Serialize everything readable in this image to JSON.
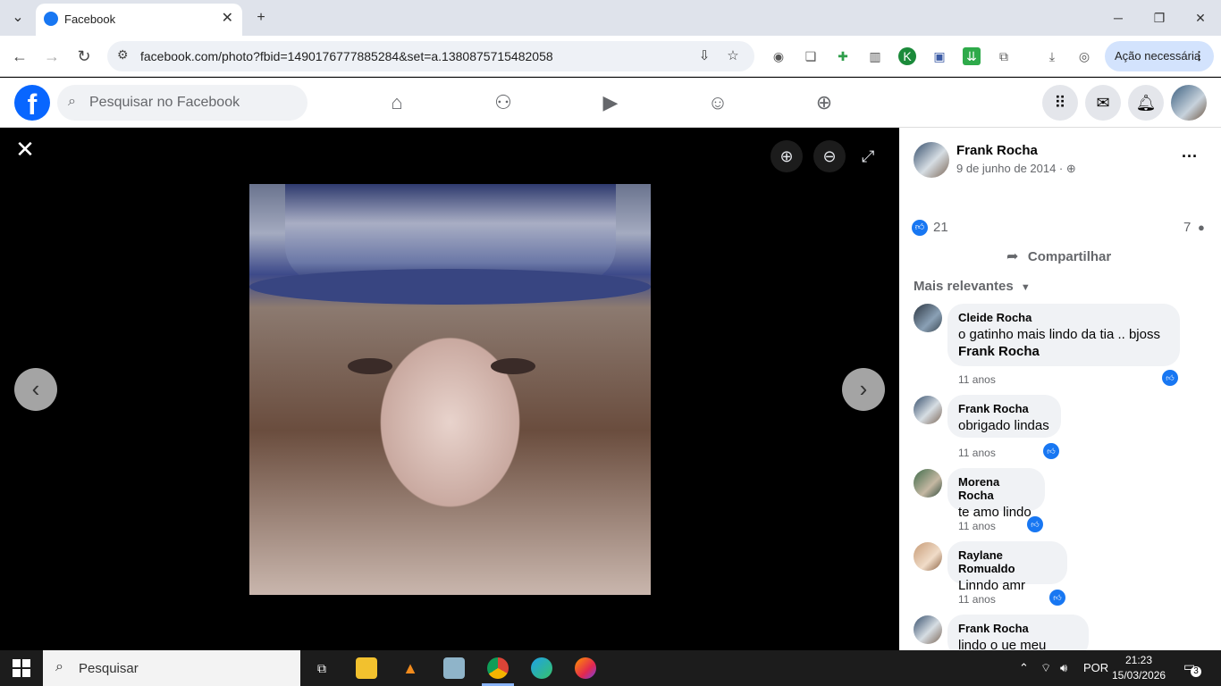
{
  "browser": {
    "tab_title": "Facebook",
    "tab_close": "✕",
    "new_tab": "+",
    "url": "facebook.com/photo?fbid=1490176777885284&set=a.1380875715482058",
    "action_button": "Ação necessária",
    "icons": [
      "back-icon",
      "forward-icon",
      "reload-icon",
      "site-info-icon",
      "install-app-icon",
      "bookmark-star-icon",
      "camera-icon",
      "copy-icon",
      "extension-plus-icon",
      "trash-icon",
      "k-extension-icon",
      "save-icon",
      "download-extension-icon",
      "puzzle-icon",
      "download-icon",
      "profile-icon",
      "kebab-menu-icon"
    ]
  },
  "facebook": {
    "search_placeholder": "Pesquisar no Facebook",
    "logo_letter": "f"
  },
  "viewer": {
    "close_label": "✕"
  },
  "post": {
    "author": "Frank Rocha",
    "date": "9 de junho de 2014 · ",
    "more": "···",
    "likes": "21",
    "comments": "7",
    "share_label": "Compartilhar",
    "sort_label": "Mais relevantes"
  },
  "comments": [
    {
      "name": "Cleide Rocha",
      "text": "o gatinho mais lindo da tia .. bjoss",
      "tag": "Frank Rocha",
      "time": "11 anos"
    },
    {
      "name": "Frank Rocha",
      "text": "obrigado lindas",
      "time": "11 anos"
    },
    {
      "name": "Morena Rocha",
      "text": "te amo lindo",
      "time": "11 anos"
    },
    {
      "name": "Raylane Romualdo",
      "text": "Linndo amr",
      "time": "11 anos"
    },
    {
      "name": "Frank Rocha",
      "text": "lindo o ue meu amor"
    }
  ],
  "taskbar": {
    "search_placeholder": "Pesquisar",
    "language": "POR",
    "time": "21:23",
    "date": "15/03/2026",
    "notifications": "3"
  },
  "colors": {
    "facebook_blue": "#0866ff",
    "like_blue": "#1877f2",
    "viewer_bg": "#000000",
    "panel_bg": "#ffffff",
    "taskbar_bg": "#1c1c1c"
  }
}
